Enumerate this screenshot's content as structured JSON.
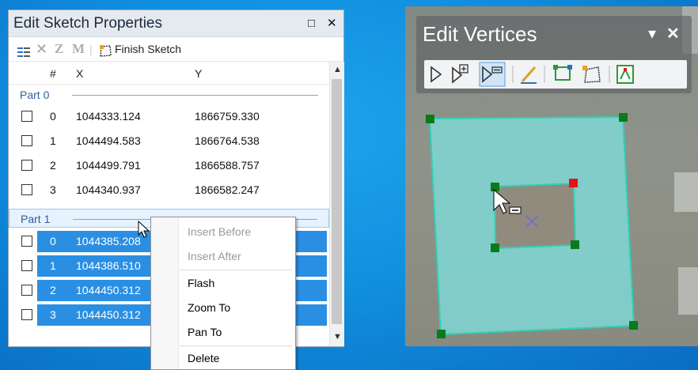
{
  "sketch_window": {
    "title": "Edit Sketch Properties",
    "maximize_icon": "□",
    "close_icon": "✕",
    "toolbar": {
      "z_label": "Z",
      "m_label": "M",
      "finish_label": "Finish Sketch"
    },
    "headers": {
      "index": "#",
      "x": "X",
      "y": "Y"
    },
    "parts": [
      {
        "label": "Part 0",
        "rows": [
          {
            "i": "0",
            "x": "1044333.124",
            "y": "1866759.330"
          },
          {
            "i": "1",
            "x": "1044494.583",
            "y": "1866764.538"
          },
          {
            "i": "2",
            "x": "1044499.791",
            "y": "1866588.757"
          },
          {
            "i": "3",
            "x": "1044340.937",
            "y": "1866582.247"
          }
        ]
      },
      {
        "label": "Part 1",
        "rows": [
          {
            "i": "0",
            "x": "1044385.208"
          },
          {
            "i": "1",
            "x": "1044386.510"
          },
          {
            "i": "2",
            "x": "1044450.312"
          },
          {
            "i": "3",
            "x": "1044450.312"
          }
        ]
      }
    ]
  },
  "context_menu": {
    "items": [
      "Insert Before",
      "Insert After",
      "Flash",
      "Zoom To",
      "Pan To",
      "Delete"
    ]
  },
  "edit_vertices": {
    "title": "Edit Vertices",
    "close_icon": "✕",
    "dropdown_icon": "▾"
  },
  "colors": {
    "background": "#1190df",
    "selection": "#2a8fe3",
    "polygon_fill": "#7fdad8",
    "polygon_stroke": "#2fd1b8",
    "vertex": "#0a7a1c",
    "selected_vertex": "#e0141c"
  }
}
